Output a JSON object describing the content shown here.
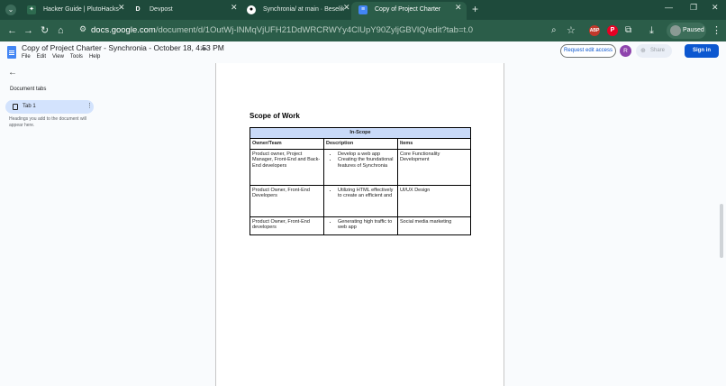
{
  "browser": {
    "tabs": [
      {
        "title": "Hacker Guide | PlutoHacks",
        "favicon": "plutohacks-icon",
        "favicon_color": "#2d6a4f",
        "active": false
      },
      {
        "title": "Devpost",
        "favicon": "devpost-icon",
        "favicon_letter": "D",
        "favicon_color": "#1e4a3b",
        "active": false
      },
      {
        "title": "Synchronia/ at main · Beselik/Sy",
        "favicon": "github-icon",
        "favicon_color": "#000000",
        "active": false
      },
      {
        "title": "Copy of Project Charter - Synch",
        "favicon": "docs-icon",
        "favicon_color": "#4285f4",
        "active": true
      }
    ],
    "new_tab": "+",
    "close_glyph": "✕",
    "url": {
      "host": "docs.google.com",
      "path": "/document/d/1OutWj-lNMqVjUFH21DdWRCRWYy4ClUpY90ZyljGBVlQ/edit?tab=t.0"
    },
    "paused_label": "Paused",
    "colors": {
      "frame": "#1e4a3b",
      "toolbar": "#2b5d49"
    }
  },
  "docs": {
    "title": "Copy of Project Charter - Synchronia - October 18, 4:53 PM",
    "menu": [
      "File",
      "Edit",
      "View",
      "Tools",
      "Help"
    ],
    "request_edit_label": "Request edit access",
    "avatar_letter": "R",
    "share_label": "Share",
    "sign_in_label": "Sign in",
    "accent": "#0b57d0"
  },
  "sidebar": {
    "heading": "Document tabs",
    "tab_label": "Tab 1",
    "hint": "Headings you add to the document will appear here."
  },
  "document": {
    "section_title": "Scope of Work",
    "table": {
      "caption": "In-Scope",
      "headers": [
        "Owner/Team",
        "Description",
        "Items"
      ],
      "rows": [
        {
          "owner": "Product owner, Project Manager, Front-End and Back-End developers",
          "description": [
            "Develop a web app",
            "Creating the foundational features of Synchronia"
          ],
          "items": "Core Functionality Development"
        },
        {
          "owner": "Product Owner, Front-End Developers",
          "description": [
            "Utilizing HTML effectively to create an efficient and"
          ],
          "items": "UI/UX Design"
        },
        {
          "owner": "Product Owner, Front-End developers",
          "description": [
            "Generating high traffic to web app"
          ],
          "items": "Social media marketing"
        }
      ],
      "caption_color": "#c9daf8"
    }
  }
}
